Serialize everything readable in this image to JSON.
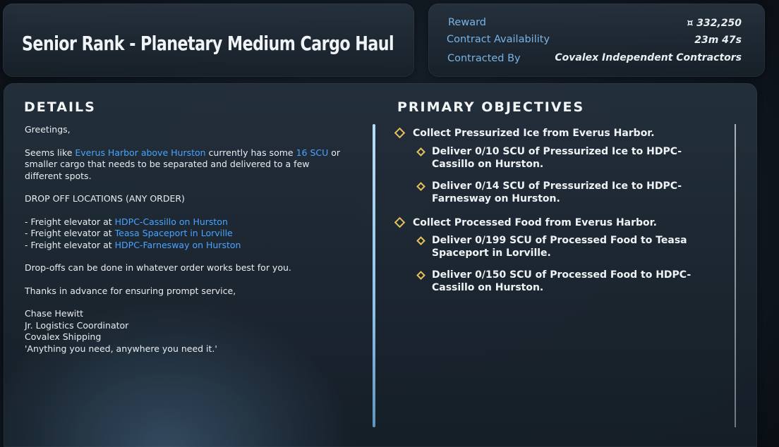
{
  "header": {
    "title": "Senior Rank - Planetary Medium Cargo Haul"
  },
  "info": {
    "reward_label": "Reward",
    "reward_value": "¤ 332,250",
    "availability_label": "Contract Availability",
    "availability_value": "23m 47s",
    "contracted_by_label": "Contracted By",
    "contracted_by_value": "Covalex Independent Contractors"
  },
  "details": {
    "heading": "DETAILS",
    "greeting": "Greetings,",
    "para1_pre": "Seems like ",
    "para1_hl1": "Everus Harbor above Hurston",
    "para1_mid": " currently has some ",
    "para1_hl2": "16 SCU",
    "para1_post": " or smaller cargo that needs to be separated and delivered to a few different spots.",
    "dropoff_heading": "DROP OFF LOCATIONS (ANY ORDER)",
    "dropoffs": [
      {
        "prefix": "- Freight elevator at ",
        "location": "HDPC-Cassillo on Hurston"
      },
      {
        "prefix": "- Freight elevator at ",
        "location": "Teasa Spaceport in Lorville"
      },
      {
        "prefix": "- Freight elevator at ",
        "location": "HDPC-Farnesway on Hurston"
      }
    ],
    "order_note": "Drop-offs can be done in whatever order works best for you.",
    "thanks": "Thanks in advance for ensuring prompt service,",
    "signature": [
      "Chase Hewitt",
      "Jr. Logistics Coordinator",
      "Covalex Shipping",
      "'Anything you need, anywhere you need it.'"
    ]
  },
  "objectives": {
    "heading": "PRIMARY OBJECTIVES",
    "items": [
      {
        "level": 1,
        "lines": [
          "Collect Pressurized Ice from Everus Harbor."
        ]
      },
      {
        "level": 2,
        "lines": [
          "Deliver 0/10 SCU of Pressurized Ice to HDPC-",
          "Cassillo on Hurston."
        ]
      },
      {
        "level": 2,
        "lines": [
          "Deliver 0/14 SCU of Pressurized Ice to HDPC-",
          "Farnesway on Hurston."
        ]
      },
      {
        "level": 1,
        "lines": [
          "Collect Processed Food from Everus Harbor."
        ]
      },
      {
        "level": 2,
        "lines": [
          "Deliver 0/199 SCU of Processed Food to Teasa",
          "Spaceport in Lorville."
        ]
      },
      {
        "level": 2,
        "lines": [
          "Deliver 0/150 SCU of Processed Food to HDPC-",
          "Cassillo on Hurston."
        ]
      }
    ]
  },
  "colors": {
    "highlight": "#4aa3ff",
    "label": "#79b4e6",
    "diamond": "#e6c25b"
  }
}
